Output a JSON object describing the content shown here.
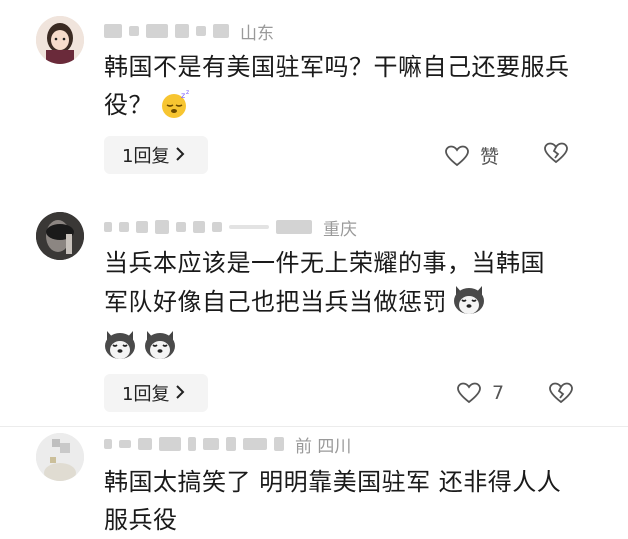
{
  "comments": [
    {
      "location": "山东",
      "text": "韩国不是有美国驻军吗？干嘛自己还要服兵役？",
      "reply_label": "1回复",
      "like_label": "赞",
      "emoji": "sleepy-face-emoji"
    },
    {
      "location": "重庆",
      "text": "当兵本应该是一件无上荣耀的事，当韩国军队好像自己也把当兵当做惩罚",
      "reply_label": "1回复",
      "like_label": "7",
      "emoji": "husky-dog-emoji"
    },
    {
      "location": "前  四川",
      "text": "韩国太搞笑了 明明靠美国驻军 还非得人人服兵役",
      "emoji": ""
    }
  ],
  "colors": {
    "reply_bg": "#f4f4f4",
    "meta_gray": "#9a9a9a",
    "text": "#1a1a1a"
  }
}
